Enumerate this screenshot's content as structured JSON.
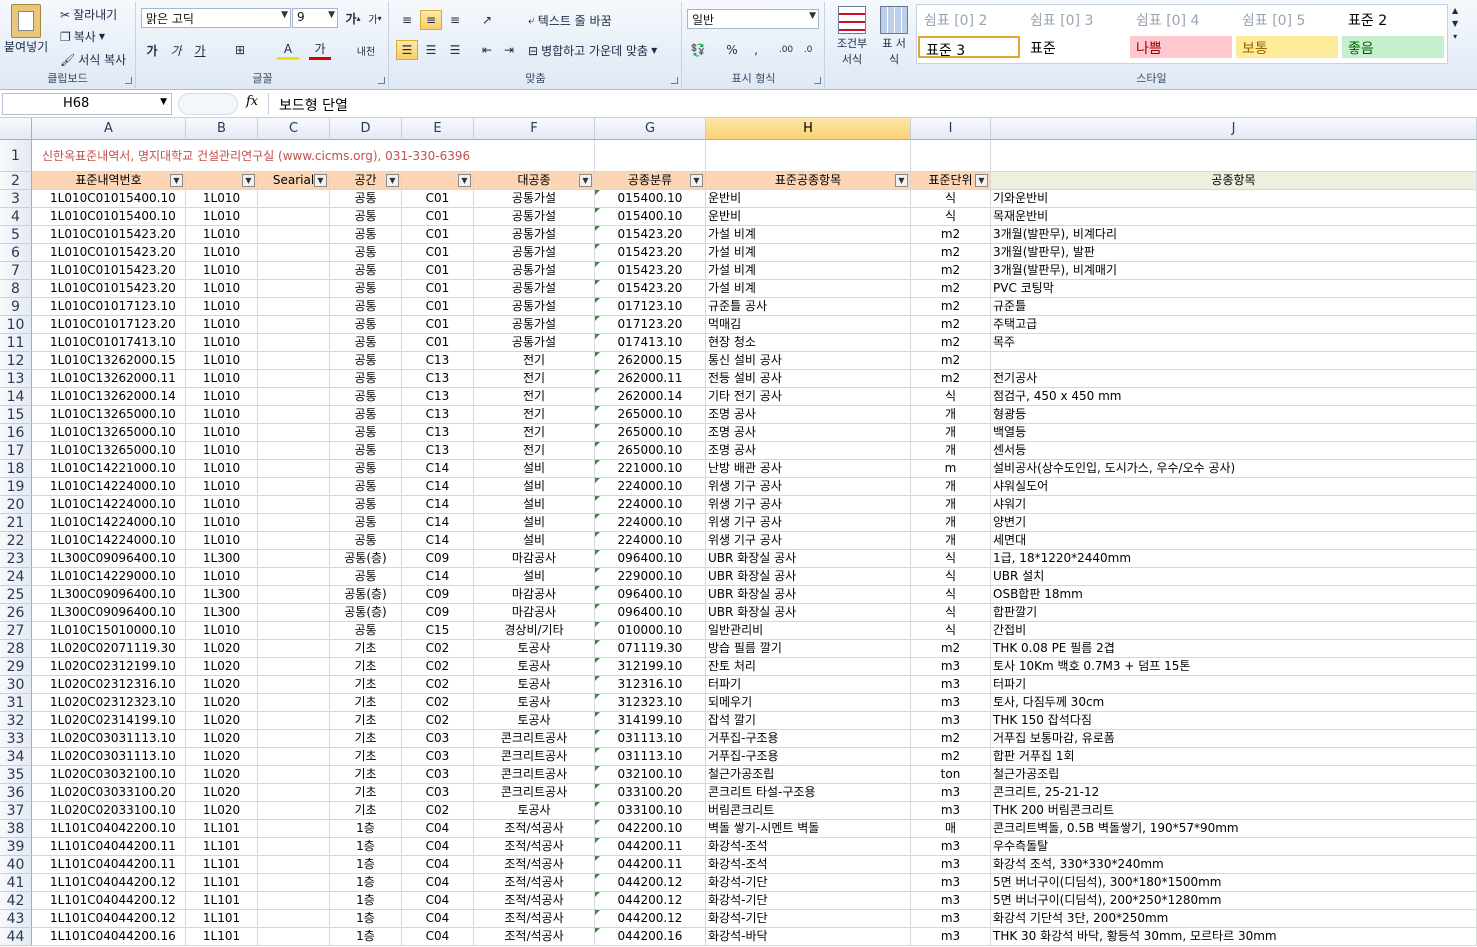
{
  "ribbon": {
    "clipboard": {
      "paste": "붙여넣기",
      "cut": "잘라내기",
      "copy": "복사",
      "format_painter": "서식 복사",
      "label": "클립보드"
    },
    "font": {
      "name": "맑은 고딕",
      "size": "9",
      "bold": "가",
      "italic": "가",
      "underline": "가",
      "grow": "가",
      "shrink": "가",
      "label": "글꼴",
      "border": "⊞",
      "fill": "A",
      "color": "가",
      "phonetic": "내천"
    },
    "align": {
      "wrap": "텍스트 줄 바꿈",
      "merge": "병합하고 가운데 맞춤",
      "label": "맞춤"
    },
    "number": {
      "format": "일반",
      "percent": "%",
      "comma": ",",
      "label": "표시 형식",
      "inc": ".00",
      "dec": ".0"
    },
    "styles": {
      "cond": "조건부 서식",
      "table": "표 서식",
      "label": "스타일",
      "items": [
        {
          "label": "쉼표 [0] 2",
          "bg": "#ffffff",
          "color": "#9aa4b4"
        },
        {
          "label": "쉼표 [0] 3",
          "bg": "#ffffff",
          "color": "#9aa4b4"
        },
        {
          "label": "쉼표 [0] 4",
          "bg": "#ffffff",
          "color": "#9aa4b4"
        },
        {
          "label": "쉼표 [0] 5",
          "bg": "#ffffff",
          "color": "#9aa4b4"
        },
        {
          "label": "표준 2",
          "bg": "#ffffff",
          "color": "#000000"
        },
        {
          "label": "표준 3",
          "bg": "#ffffff",
          "color": "#000000"
        },
        {
          "label": "표준",
          "bg": "#ffffff",
          "color": "#000000"
        },
        {
          "label": "나쁨",
          "bg": "#ffc7ce",
          "color": "#9c0006"
        },
        {
          "label": "보통",
          "bg": "#ffeb9c",
          "color": "#9c6500"
        },
        {
          "label": "좋음",
          "bg": "#c6efce",
          "color": "#006100"
        }
      ]
    }
  },
  "formula_bar": {
    "name_box": "H68",
    "fx": "fx",
    "value": "보드형 단열"
  },
  "columns": [
    "A",
    "B",
    "C",
    "D",
    "E",
    "F",
    "G",
    "H",
    "I",
    "J"
  ],
  "selected_column": "H",
  "row1_text": "신한옥표준내역서, 명지대학교 건설관리연구실 (www.cicms.org), 031-330-6396",
  "headers": [
    "표준내역번호",
    "",
    "Searial",
    "공간",
    "",
    "대공종",
    "공종분류",
    "표준공종항목",
    "표준단위",
    "공종항목"
  ],
  "rows": [
    [
      "3",
      "1L010C01015400.10",
      "1L010",
      "",
      "공통",
      "C01",
      "공통가설",
      "015400.10",
      "운반비",
      "식",
      "기와운반비"
    ],
    [
      "4",
      "1L010C01015400.10",
      "1L010",
      "",
      "공통",
      "C01",
      "공통가설",
      "015400.10",
      "운반비",
      "식",
      "목재운반비"
    ],
    [
      "5",
      "1L010C01015423.20",
      "1L010",
      "",
      "공통",
      "C01",
      "공통가설",
      "015423.20",
      "가설 비계",
      "m2",
      "3개월(발판무), 비계다리"
    ],
    [
      "6",
      "1L010C01015423.20",
      "1L010",
      "",
      "공통",
      "C01",
      "공통가설",
      "015423.20",
      "가설 비계",
      "m2",
      "3개월(발판무), 발판"
    ],
    [
      "7",
      "1L010C01015423.20",
      "1L010",
      "",
      "공통",
      "C01",
      "공통가설",
      "015423.20",
      "가설 비계",
      "m2",
      "3개월(발판무), 비계매기"
    ],
    [
      "8",
      "1L010C01015423.20",
      "1L010",
      "",
      "공통",
      "C01",
      "공통가설",
      "015423.20",
      "가설 비계",
      "m2",
      "PVC 코팅막"
    ],
    [
      "9",
      "1L010C01017123.10",
      "1L010",
      "",
      "공통",
      "C01",
      "공통가설",
      "017123.10",
      "규준틀 공사",
      "m2",
      "규준틀"
    ],
    [
      "10",
      "1L010C01017123.20",
      "1L010",
      "",
      "공통",
      "C01",
      "공통가설",
      "017123.20",
      "먹매김",
      "m2",
      "주택고급"
    ],
    [
      "11",
      "1L010C01017413.10",
      "1L010",
      "",
      "공통",
      "C01",
      "공통가설",
      "017413.10",
      "현장 청소",
      "m2",
      "목주"
    ],
    [
      "12",
      "1L010C13262000.15",
      "1L010",
      "",
      "공통",
      "C13",
      "전기",
      "262000.15",
      "통신 설비 공사",
      "m2",
      ""
    ],
    [
      "13",
      "1L010C13262000.11",
      "1L010",
      "",
      "공통",
      "C13",
      "전기",
      "262000.11",
      "전등 설비 공사",
      "m2",
      "전기공사"
    ],
    [
      "14",
      "1L010C13262000.14",
      "1L010",
      "",
      "공통",
      "C13",
      "전기",
      "262000.14",
      "기타 전기 공사",
      "식",
      "점검구, 450 x 450 mm"
    ],
    [
      "15",
      "1L010C13265000.10",
      "1L010",
      "",
      "공통",
      "C13",
      "전기",
      "265000.10",
      "조명 공사",
      "개",
      "형광등"
    ],
    [
      "16",
      "1L010C13265000.10",
      "1L010",
      "",
      "공통",
      "C13",
      "전기",
      "265000.10",
      "조명 공사",
      "개",
      "백열등"
    ],
    [
      "17",
      "1L010C13265000.10",
      "1L010",
      "",
      "공통",
      "C13",
      "전기",
      "265000.10",
      "조명 공사",
      "개",
      "센서등"
    ],
    [
      "18",
      "1L010C14221000.10",
      "1L010",
      "",
      "공통",
      "C14",
      "설비",
      "221000.10",
      "난방 배관 공사",
      "m",
      "설비공사(상수도인입, 도시가스, 우수/오수 공사)"
    ],
    [
      "19",
      "1L010C14224000.10",
      "1L010",
      "",
      "공통",
      "C14",
      "설비",
      "224000.10",
      "위생 기구 공사",
      "개",
      "샤워실도어"
    ],
    [
      "20",
      "1L010C14224000.10",
      "1L010",
      "",
      "공통",
      "C14",
      "설비",
      "224000.10",
      "위생 기구 공사",
      "개",
      "샤워기"
    ],
    [
      "21",
      "1L010C14224000.10",
      "1L010",
      "",
      "공통",
      "C14",
      "설비",
      "224000.10",
      "위생 기구 공사",
      "개",
      "양변기"
    ],
    [
      "22",
      "1L010C14224000.10",
      "1L010",
      "",
      "공통",
      "C14",
      "설비",
      "224000.10",
      "위생 기구 공사",
      "개",
      "세면대"
    ],
    [
      "23",
      "1L300C09096400.10",
      "1L300",
      "",
      "공통(층)",
      "C09",
      "마감공사",
      "096400.10",
      "UBR 화장실 공사",
      "식",
      "1급, 18*1220*2440mm"
    ],
    [
      "24",
      "1L010C14229000.10",
      "1L010",
      "",
      "공통",
      "C14",
      "설비",
      "229000.10",
      "UBR 화장실 공사",
      "식",
      "UBR 설치"
    ],
    [
      "25",
      "1L300C09096400.10",
      "1L300",
      "",
      "공통(층)",
      "C09",
      "마감공사",
      "096400.10",
      "UBR 화장실 공사",
      "식",
      "OSB합판 18mm"
    ],
    [
      "26",
      "1L300C09096400.10",
      "1L300",
      "",
      "공통(층)",
      "C09",
      "마감공사",
      "096400.10",
      "UBR 화장실 공사",
      "식",
      "합판깔기"
    ],
    [
      "27",
      "1L010C15010000.10",
      "1L010",
      "",
      "공통",
      "C15",
      "경상비/기타",
      "010000.10",
      "일반관리비",
      "식",
      "간접비"
    ],
    [
      "28",
      "1L020C02071119.30",
      "1L020",
      "",
      "기초",
      "C02",
      "토공사",
      "071119.30",
      "방습 필름 깔기",
      "m2",
      "THK 0.08 PE 필름 2겹"
    ],
    [
      "29",
      "1L020C02312199.10",
      "1L020",
      "",
      "기초",
      "C02",
      "토공사",
      "312199.10",
      "잔토 처리",
      "m3",
      "토사 10Km 백호 0.7M3 + 덤프 15톤"
    ],
    [
      "30",
      "1L020C02312316.10",
      "1L020",
      "",
      "기초",
      "C02",
      "토공사",
      "312316.10",
      "터파기",
      "m3",
      "터파기"
    ],
    [
      "31",
      "1L020C02312323.10",
      "1L020",
      "",
      "기초",
      "C02",
      "토공사",
      "312323.10",
      "되메우기",
      "m3",
      "토사, 다짐두께 30cm"
    ],
    [
      "32",
      "1L020C02314199.10",
      "1L020",
      "",
      "기초",
      "C02",
      "토공사",
      "314199.10",
      "잡석 깔기",
      "m3",
      "THK 150 잡석다짐"
    ],
    [
      "33",
      "1L020C03031113.10",
      "1L020",
      "",
      "기초",
      "C03",
      "콘크리트공사",
      "031113.10",
      "거푸집-구조용",
      "m2",
      "거푸집 보통마감, 유로폼"
    ],
    [
      "34",
      "1L020C03031113.10",
      "1L020",
      "",
      "기초",
      "C03",
      "콘크리트공사",
      "031113.10",
      "거푸집-구조용",
      "m2",
      "합판 거푸집 1회"
    ],
    [
      "35",
      "1L020C03032100.10",
      "1L020",
      "",
      "기초",
      "C03",
      "콘크리트공사",
      "032100.10",
      "철근가공조립",
      "ton",
      "철근가공조립"
    ],
    [
      "36",
      "1L020C03033100.20",
      "1L020",
      "",
      "기초",
      "C03",
      "콘크리트공사",
      "033100.20",
      "콘크리트 타설-구조용",
      "m3",
      "콘크리트, 25-21-12"
    ],
    [
      "37",
      "1L020C02033100.10",
      "1L020",
      "",
      "기초",
      "C02",
      "토공사",
      "033100.10",
      "버림콘크리트",
      "m3",
      "THK 200 버림콘크리트"
    ],
    [
      "38",
      "1L101C04042200.10",
      "1L101",
      "",
      "1층",
      "C04",
      "조적/석공사",
      "042200.10",
      "벽돌 쌓기-시멘트 벽돌",
      "매",
      "콘크리트벽돌, 0.5B 벽돌쌓기, 190*57*90mm"
    ],
    [
      "39",
      "1L101C04044200.11",
      "1L101",
      "",
      "1층",
      "C04",
      "조적/석공사",
      "044200.11",
      "화강석-조석",
      "m3",
      "우수측돌탈"
    ],
    [
      "40",
      "1L101C04044200.11",
      "1L101",
      "",
      "1층",
      "C04",
      "조적/석공사",
      "044200.11",
      "화강석-조석",
      "m3",
      "화강석 조석, 330*330*240mm"
    ],
    [
      "41",
      "1L101C04044200.12",
      "1L101",
      "",
      "1층",
      "C04",
      "조적/석공사",
      "044200.12",
      "화강석-기단",
      "m3",
      "5면 버너구이(디딤석), 300*180*1500mm"
    ],
    [
      "42",
      "1L101C04044200.12",
      "1L101",
      "",
      "1층",
      "C04",
      "조적/석공사",
      "044200.12",
      "화강석-기단",
      "m3",
      "5면 버너구이(디딤석), 200*250*1280mm"
    ],
    [
      "43",
      "1L101C04044200.12",
      "1L101",
      "",
      "1층",
      "C04",
      "조적/석공사",
      "044200.12",
      "화강석-기단",
      "m3",
      "화강석 기단석 3단, 200*250mm"
    ],
    [
      "44",
      "1L101C04044200.16",
      "1L101",
      "",
      "1층",
      "C04",
      "조적/석공사",
      "044200.16",
      "화강석-바닥",
      "m3",
      "THK 30 화강석 바닥, 황등석 30mm, 모르타르 30mm"
    ]
  ]
}
